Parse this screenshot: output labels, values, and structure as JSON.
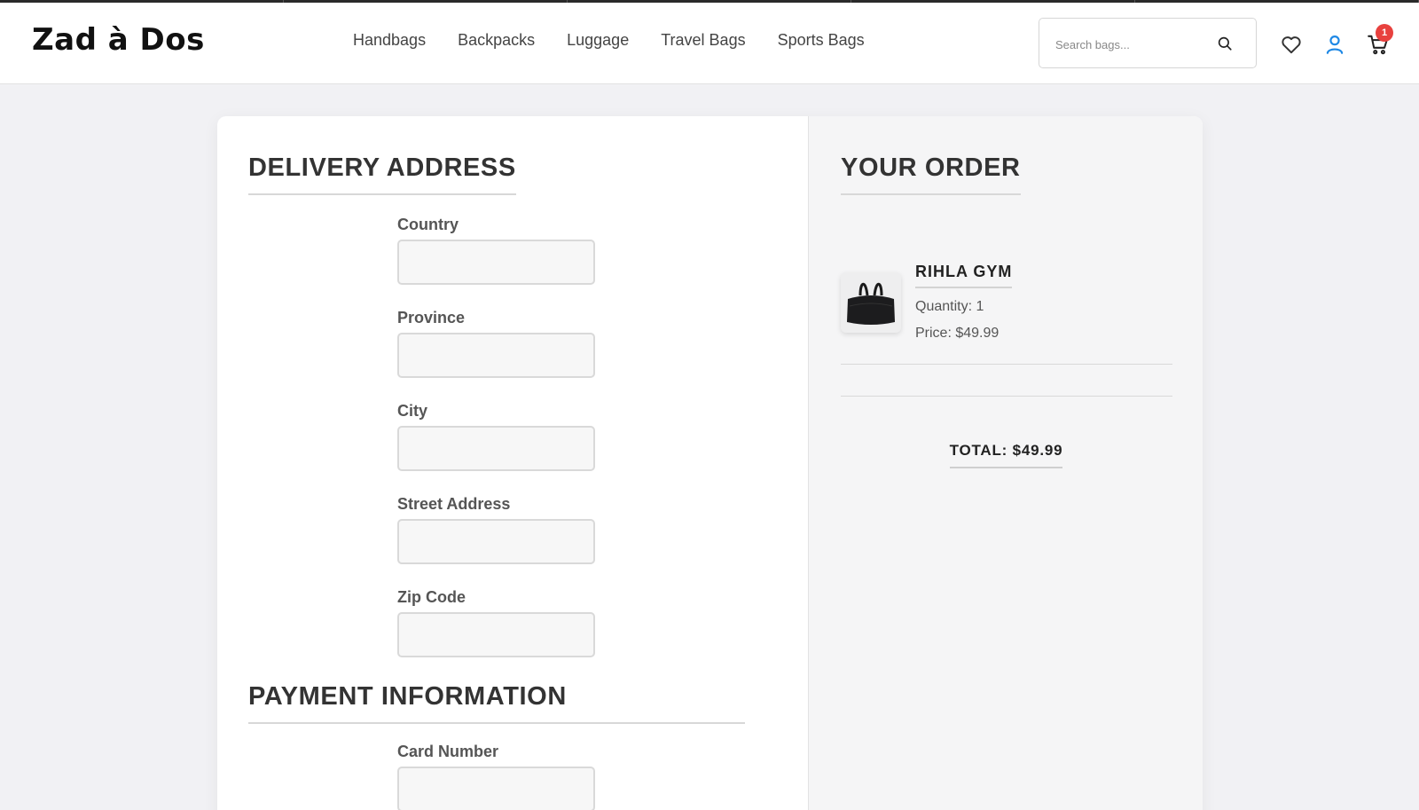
{
  "brand": {
    "name": "Zad à Dos"
  },
  "nav": {
    "items": [
      "Handbags",
      "Backpacks",
      "Luggage",
      "Travel Bags",
      "Sports Bags"
    ]
  },
  "search": {
    "placeholder": "Search bags...",
    "icon": "search-icon"
  },
  "header_icons": {
    "wishlist": "heart-icon",
    "account": "user-icon",
    "cart": "cart-icon",
    "cart_count": "1"
  },
  "colors": {
    "accent": "#1e88e5",
    "badge": "#e8413e"
  },
  "delivery": {
    "title": "DELIVERY ADDRESS",
    "fields": [
      {
        "label": "Country",
        "value": ""
      },
      {
        "label": "Province",
        "value": ""
      },
      {
        "label": "City",
        "value": ""
      },
      {
        "label": "Street Address",
        "value": ""
      },
      {
        "label": "Zip Code",
        "value": ""
      }
    ]
  },
  "payment": {
    "title": "PAYMENT INFORMATION",
    "fields": [
      {
        "label": "Card Number",
        "value": ""
      }
    ]
  },
  "order": {
    "title": "YOUR ORDER",
    "items": [
      {
        "name": "RIHLA GYM",
        "quantity": "Quantity: 1",
        "price": "Price: $49.99"
      }
    ],
    "total": "TOTAL: $49.99"
  }
}
